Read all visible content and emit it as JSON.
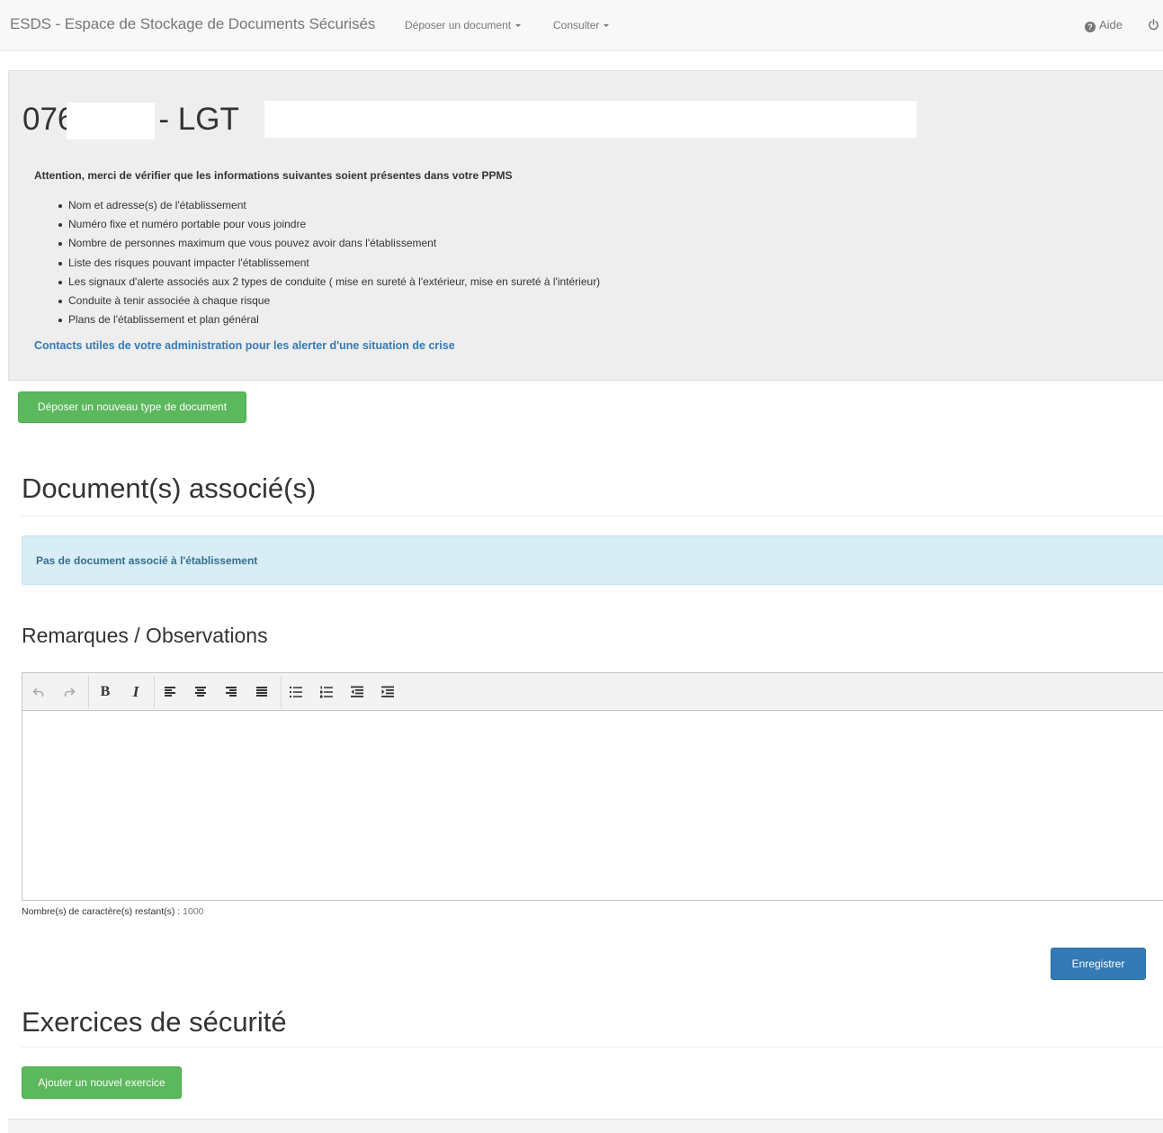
{
  "navbar": {
    "brand": "ESDS - Espace de Stockage de Documents Sécurisés",
    "menu": [
      {
        "label": "Déposer un document"
      },
      {
        "label": "Consulter"
      }
    ],
    "help_label": "Aide",
    "help_icon": "question-circle-icon",
    "power_icon": "power-off-icon"
  },
  "establishment": {
    "code_prefix": "076",
    "separator": "- LGT"
  },
  "notice": {
    "warning": "Attention, merci de vérifier que les informations suivantes soient présentes dans votre PPMS",
    "items": [
      "Nom et adresse(s) de l'établissement",
      "Numéro fixe et numéro portable pour vous joindre",
      "Nombre de personnes maximum que vous pouvez avoir dans l'établissement",
      "Liste des risques pouvant impacter l'établissement",
      "Les signaux d'alerte associés aux 2 types de conduite ( mise en sureté à l'extérieur, mise en sureté à l'intérieur)",
      "Conduite à tenir associée à chaque risque",
      "Plans de l'établissement et plan général"
    ],
    "contacts_link": "Contacts utiles de votre administration pour les alerter d'une situation de crise"
  },
  "actions": {
    "deposit_new_type": "Déposer un nouveau type de document"
  },
  "documents": {
    "heading": "Document(s) associé(s)",
    "empty_message": "Pas de document associé à l'établissement"
  },
  "remarks": {
    "heading": "Remarques / Observations",
    "toolbar_icons": [
      "undo-icon",
      "redo-icon",
      "bold-icon",
      "italic-icon",
      "align-left-icon",
      "align-center-icon",
      "align-right-icon",
      "align-justify-icon",
      "bullet-list-icon",
      "numbered-list-icon",
      "outdent-icon",
      "indent-icon"
    ],
    "bold_glyph": "B",
    "italic_glyph": "I",
    "char_count_label": "Nombre(s) de caractère(s) restant(s) :",
    "char_count_value": "1000",
    "save_button": "Enregistrer"
  },
  "exercises": {
    "heading": "Exercices de sécurité",
    "add_button": "Ajouter un nouvel exercice"
  },
  "colors": {
    "success": "#5cb85c",
    "primary": "#337ab7",
    "link": "#337ab7",
    "info_bg": "#d9edf7",
    "info_text": "#31708f"
  }
}
